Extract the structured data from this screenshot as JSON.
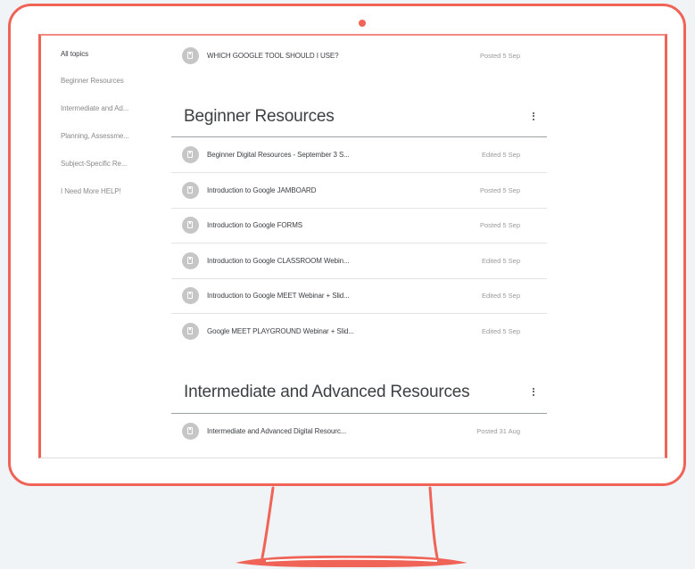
{
  "sidebar": {
    "items": [
      {
        "label": "All topics"
      },
      {
        "label": "Beginner Resources"
      },
      {
        "label": "Intermediate and Ad..."
      },
      {
        "label": "Planning, Assessme..."
      },
      {
        "label": "Subject-Specific Re..."
      },
      {
        "label": "I Need More HELP!"
      }
    ]
  },
  "pinned": {
    "title": "WHICH GOOGLE TOOL SHOULD I USE?",
    "status": "Posted 5 Sep"
  },
  "sections": [
    {
      "title": "Beginner Resources",
      "items": [
        {
          "title": "Beginner Digital Resources - September 3 S...",
          "status": "Edited 5 Sep"
        },
        {
          "title": "Introduction to Google JAMBOARD",
          "status": "Posted 5 Sep"
        },
        {
          "title": "Introduction to Google FORMS",
          "status": "Posted 5 Sep"
        },
        {
          "title": "Introduction to Google CLASSROOM Webin...",
          "status": "Edited 5 Sep"
        },
        {
          "title": "Introduction to Google MEET Webinar + Slid...",
          "status": "Edited 5 Sep"
        },
        {
          "title": "Google MEET PLAYGROUND Webinar + Slid...",
          "status": "Edited 5 Sep"
        }
      ]
    },
    {
      "title": "Intermediate and Advanced Resources",
      "items": [
        {
          "title": "Intermediate and Advanced Digital Resourc...",
          "status": "Posted 31 Aug"
        }
      ]
    }
  ],
  "colors": {
    "frame": "#ef6456",
    "background": "#f1f4f7",
    "icon": "#c6c6c6",
    "text": "#3c4043",
    "muted": "#9a9a9a"
  },
  "icons": {
    "post": "assignment-icon",
    "menu": "more-vert-icon"
  }
}
